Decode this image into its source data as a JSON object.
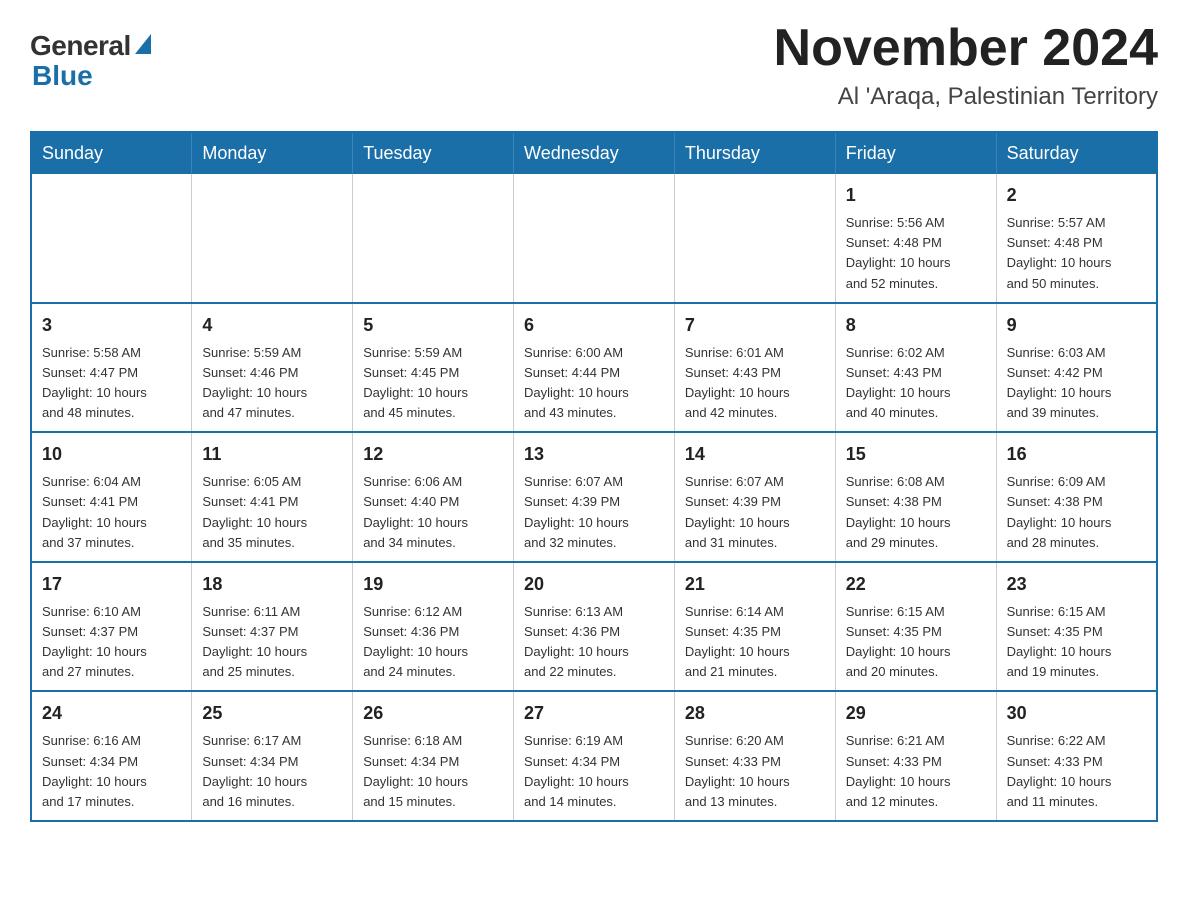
{
  "logo": {
    "general": "General",
    "blue": "Blue"
  },
  "title": "November 2024",
  "location": "Al 'Araqa, Palestinian Territory",
  "headers": [
    "Sunday",
    "Monday",
    "Tuesday",
    "Wednesday",
    "Thursday",
    "Friday",
    "Saturday"
  ],
  "weeks": [
    [
      {
        "day": "",
        "info": ""
      },
      {
        "day": "",
        "info": ""
      },
      {
        "day": "",
        "info": ""
      },
      {
        "day": "",
        "info": ""
      },
      {
        "day": "",
        "info": ""
      },
      {
        "day": "1",
        "info": "Sunrise: 5:56 AM\nSunset: 4:48 PM\nDaylight: 10 hours\nand 52 minutes."
      },
      {
        "day": "2",
        "info": "Sunrise: 5:57 AM\nSunset: 4:48 PM\nDaylight: 10 hours\nand 50 minutes."
      }
    ],
    [
      {
        "day": "3",
        "info": "Sunrise: 5:58 AM\nSunset: 4:47 PM\nDaylight: 10 hours\nand 48 minutes."
      },
      {
        "day": "4",
        "info": "Sunrise: 5:59 AM\nSunset: 4:46 PM\nDaylight: 10 hours\nand 47 minutes."
      },
      {
        "day": "5",
        "info": "Sunrise: 5:59 AM\nSunset: 4:45 PM\nDaylight: 10 hours\nand 45 minutes."
      },
      {
        "day": "6",
        "info": "Sunrise: 6:00 AM\nSunset: 4:44 PM\nDaylight: 10 hours\nand 43 minutes."
      },
      {
        "day": "7",
        "info": "Sunrise: 6:01 AM\nSunset: 4:43 PM\nDaylight: 10 hours\nand 42 minutes."
      },
      {
        "day": "8",
        "info": "Sunrise: 6:02 AM\nSunset: 4:43 PM\nDaylight: 10 hours\nand 40 minutes."
      },
      {
        "day": "9",
        "info": "Sunrise: 6:03 AM\nSunset: 4:42 PM\nDaylight: 10 hours\nand 39 minutes."
      }
    ],
    [
      {
        "day": "10",
        "info": "Sunrise: 6:04 AM\nSunset: 4:41 PM\nDaylight: 10 hours\nand 37 minutes."
      },
      {
        "day": "11",
        "info": "Sunrise: 6:05 AM\nSunset: 4:41 PM\nDaylight: 10 hours\nand 35 minutes."
      },
      {
        "day": "12",
        "info": "Sunrise: 6:06 AM\nSunset: 4:40 PM\nDaylight: 10 hours\nand 34 minutes."
      },
      {
        "day": "13",
        "info": "Sunrise: 6:07 AM\nSunset: 4:39 PM\nDaylight: 10 hours\nand 32 minutes."
      },
      {
        "day": "14",
        "info": "Sunrise: 6:07 AM\nSunset: 4:39 PM\nDaylight: 10 hours\nand 31 minutes."
      },
      {
        "day": "15",
        "info": "Sunrise: 6:08 AM\nSunset: 4:38 PM\nDaylight: 10 hours\nand 29 minutes."
      },
      {
        "day": "16",
        "info": "Sunrise: 6:09 AM\nSunset: 4:38 PM\nDaylight: 10 hours\nand 28 minutes."
      }
    ],
    [
      {
        "day": "17",
        "info": "Sunrise: 6:10 AM\nSunset: 4:37 PM\nDaylight: 10 hours\nand 27 minutes."
      },
      {
        "day": "18",
        "info": "Sunrise: 6:11 AM\nSunset: 4:37 PM\nDaylight: 10 hours\nand 25 minutes."
      },
      {
        "day": "19",
        "info": "Sunrise: 6:12 AM\nSunset: 4:36 PM\nDaylight: 10 hours\nand 24 minutes."
      },
      {
        "day": "20",
        "info": "Sunrise: 6:13 AM\nSunset: 4:36 PM\nDaylight: 10 hours\nand 22 minutes."
      },
      {
        "day": "21",
        "info": "Sunrise: 6:14 AM\nSunset: 4:35 PM\nDaylight: 10 hours\nand 21 minutes."
      },
      {
        "day": "22",
        "info": "Sunrise: 6:15 AM\nSunset: 4:35 PM\nDaylight: 10 hours\nand 20 minutes."
      },
      {
        "day": "23",
        "info": "Sunrise: 6:15 AM\nSunset: 4:35 PM\nDaylight: 10 hours\nand 19 minutes."
      }
    ],
    [
      {
        "day": "24",
        "info": "Sunrise: 6:16 AM\nSunset: 4:34 PM\nDaylight: 10 hours\nand 17 minutes."
      },
      {
        "day": "25",
        "info": "Sunrise: 6:17 AM\nSunset: 4:34 PM\nDaylight: 10 hours\nand 16 minutes."
      },
      {
        "day": "26",
        "info": "Sunrise: 6:18 AM\nSunset: 4:34 PM\nDaylight: 10 hours\nand 15 minutes."
      },
      {
        "day": "27",
        "info": "Sunrise: 6:19 AM\nSunset: 4:34 PM\nDaylight: 10 hours\nand 14 minutes."
      },
      {
        "day": "28",
        "info": "Sunrise: 6:20 AM\nSunset: 4:33 PM\nDaylight: 10 hours\nand 13 minutes."
      },
      {
        "day": "29",
        "info": "Sunrise: 6:21 AM\nSunset: 4:33 PM\nDaylight: 10 hours\nand 12 minutes."
      },
      {
        "day": "30",
        "info": "Sunrise: 6:22 AM\nSunset: 4:33 PM\nDaylight: 10 hours\nand 11 minutes."
      }
    ]
  ]
}
